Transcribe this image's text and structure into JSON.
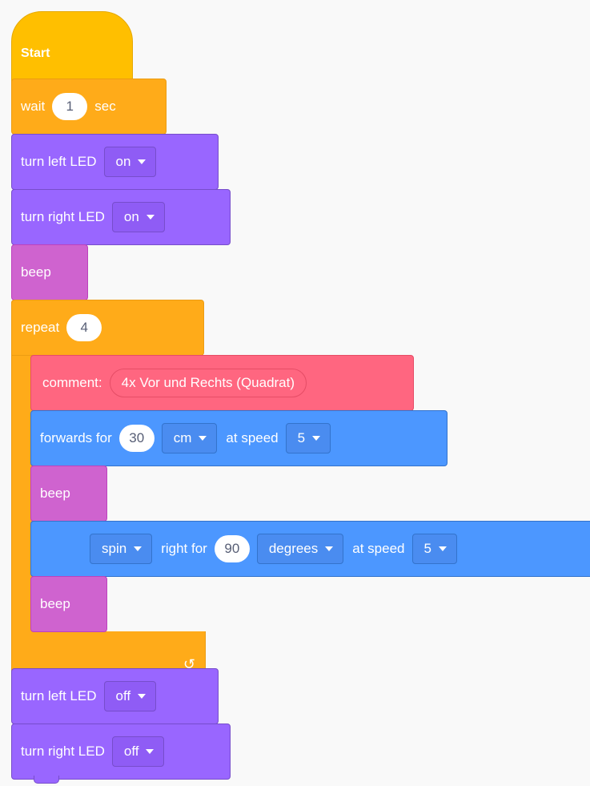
{
  "blocks": {
    "start": {
      "label": "Start"
    },
    "wait": {
      "label": "wait",
      "value": "1",
      "unit": "sec"
    },
    "turn_left_led_on": {
      "label": "turn left LED",
      "state": "on"
    },
    "turn_right_led_on": {
      "label": "turn right LED",
      "state": "on"
    },
    "beep_1": {
      "label": "beep"
    },
    "repeat": {
      "label": "repeat",
      "count": "4",
      "loop_icon": "↺"
    },
    "comment": {
      "label": "comment:",
      "text": "4x Vor und Rechts (Quadrat)"
    },
    "forwards": {
      "label": "forwards for",
      "distance": "30",
      "unit": "cm",
      "speed_label": "at speed",
      "speed": "5"
    },
    "beep_2": {
      "label": "beep"
    },
    "spin": {
      "mode": "spin",
      "label": "right for",
      "angle": "90",
      "unit": "degrees",
      "speed_label": "at speed",
      "speed": "5"
    },
    "beep_3": {
      "label": "beep"
    },
    "turn_left_led_off": {
      "label": "turn left LED",
      "state": "off"
    },
    "turn_right_led_off": {
      "label": "turn right LED",
      "state": "off"
    }
  },
  "colors": {
    "event": "#ffbf00",
    "control": "#ffab19",
    "looks": "#9966ff",
    "sound": "#cf63cf",
    "comment": "#ff6680",
    "motion": "#4c97ff",
    "canvas": "#f9f9f9"
  }
}
